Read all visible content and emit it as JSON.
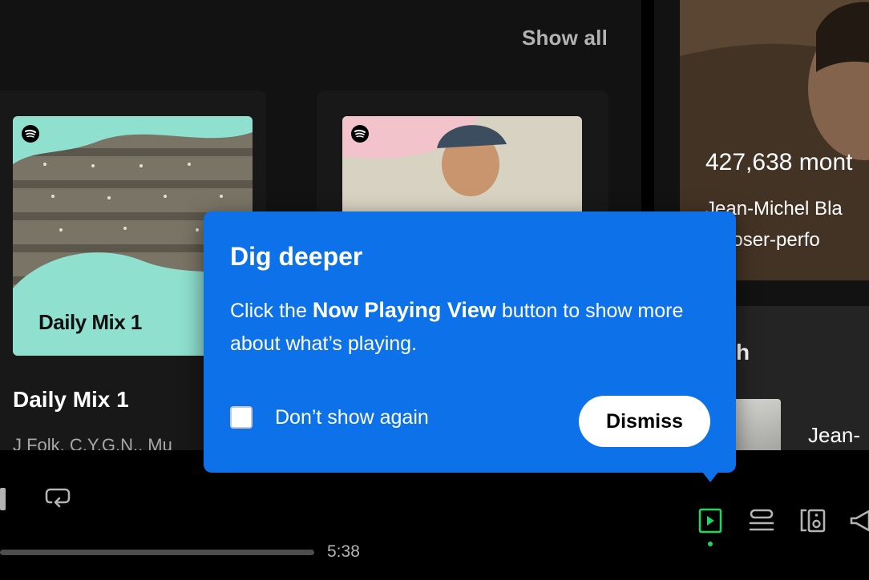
{
  "main": {
    "show_all_label": "Show all",
    "cards": [
      {
        "cover_title": "Daily Mix 1",
        "title": "Daily Mix 1",
        "subtitle": "J Folk, C.Y.G.N., Mu"
      },
      {
        "cover_title": "",
        "title": "",
        "subtitle": ""
      }
    ]
  },
  "right_panel": {
    "monthly_listeners": "427,638 mont",
    "bio_line1": "Jean-Michel Bla",
    "bio_line2": "mposer-perfo",
    "merch_heading": "erch",
    "merch_item_label": "Jean-"
  },
  "player": {
    "time_total": "5:38"
  },
  "tooltip": {
    "title": "Dig deeper",
    "body_prefix": "Click the ",
    "body_highlight": "Now Playing View",
    "body_suffix": " button to show more about what’s playing.",
    "checkbox_label": "Don’t show again",
    "dismiss_label": "Dismiss"
  },
  "colors": {
    "tooltip_bg": "#0d72ea",
    "accent_green": "#1ed760",
    "background": "#121212"
  },
  "icons": {
    "repeat": "repeat-icon",
    "now_playing_view": "now-playing-view-icon",
    "queue": "queue-icon",
    "connect_device": "connect-device-icon",
    "volume": "volume-icon",
    "spotify": "spotify-logo-icon"
  }
}
